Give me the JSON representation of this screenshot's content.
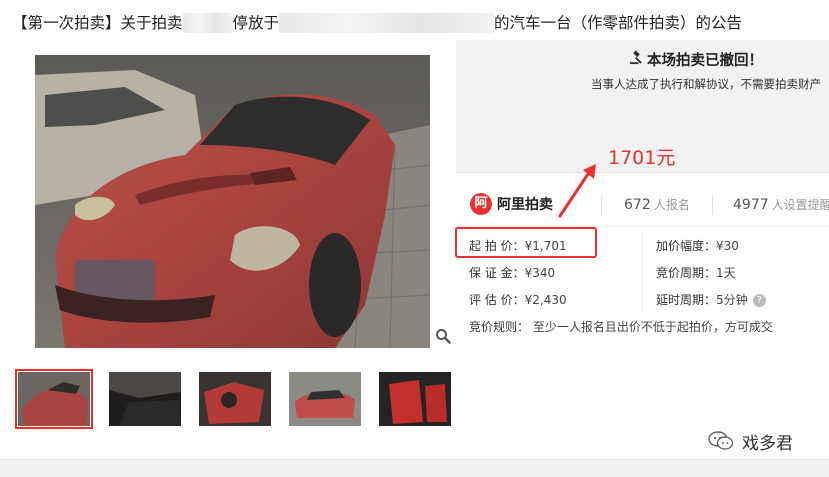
{
  "listing": {
    "title_part1": "【第一次拍卖】关于拍卖",
    "title_part2": "停放于",
    "title_part3": "的汽车一台（作零部件拍卖）的公告"
  },
  "status": {
    "title": "本场拍卖已撤回！",
    "subtitle": "当事人达成了执行和解协议，不需要拍卖财产"
  },
  "annotation": {
    "price": "1701元"
  },
  "brand": {
    "logo_char": "阿",
    "name": "阿里拍卖"
  },
  "stats": {
    "signups": "672",
    "signups_unit": "人报名",
    "reminders": "4977",
    "reminders_unit": "人设置提醒"
  },
  "info": {
    "start_price_label": "起 拍 价：",
    "start_price": "¥1,701",
    "deposit_label": "保 证 金：",
    "deposit": "¥340",
    "appraisal_label": "评 估 价：",
    "appraisal": "¥2,430",
    "increment_label": "加价幅度：",
    "increment": "¥30",
    "cycle_label": "竞价周期：",
    "cycle": "1天",
    "extension_label": "延时周期：",
    "extension": "5分钟",
    "rule_label": "竞价规则：",
    "rule": "至少一人报名且出价不低于起拍价，方可成交"
  },
  "watermark": {
    "text": "戏多君"
  },
  "icons": {
    "gavel": "gavel-icon",
    "zoom": "magnifier-icon",
    "help": "question-icon",
    "wechat": "wechat-icon"
  },
  "colors": {
    "accent": "#e8312f",
    "panel_bg": "#f2f2f2"
  }
}
